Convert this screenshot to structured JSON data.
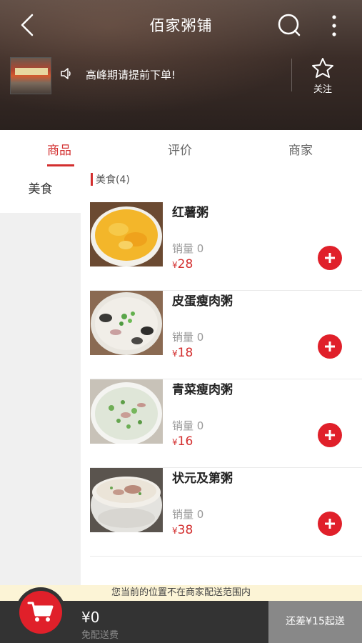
{
  "header": {
    "title": "佰家粥铺",
    "notice": "高峰期请提前下单!",
    "follow_label": "关注"
  },
  "tabs": [
    "商品",
    "评价",
    "商家"
  ],
  "sidebar": {
    "items": [
      {
        "label": "美食"
      }
    ]
  },
  "category": {
    "label": "美食(4)"
  },
  "products": [
    {
      "name": "红薯粥",
      "sales": "销量 0",
      "currency": "¥",
      "price": "28"
    },
    {
      "name": "皮蛋瘦肉粥",
      "sales": "销量 0",
      "currency": "¥",
      "price": "18"
    },
    {
      "name": "青菜瘦肉粥",
      "sales": "销量 0",
      "currency": "¥",
      "price": "16"
    },
    {
      "name": "状元及第粥",
      "sales": "销量 0",
      "currency": "¥",
      "price": "38"
    }
  ],
  "warning": "您当前的位置不在商家配送范围内",
  "cart": {
    "total": "¥0",
    "delivery": "免配送费",
    "min_order": "还差¥15起送"
  },
  "colors": {
    "accent": "#e0202a",
    "price": "#d32f2f",
    "bottom_bar": "#333333"
  }
}
